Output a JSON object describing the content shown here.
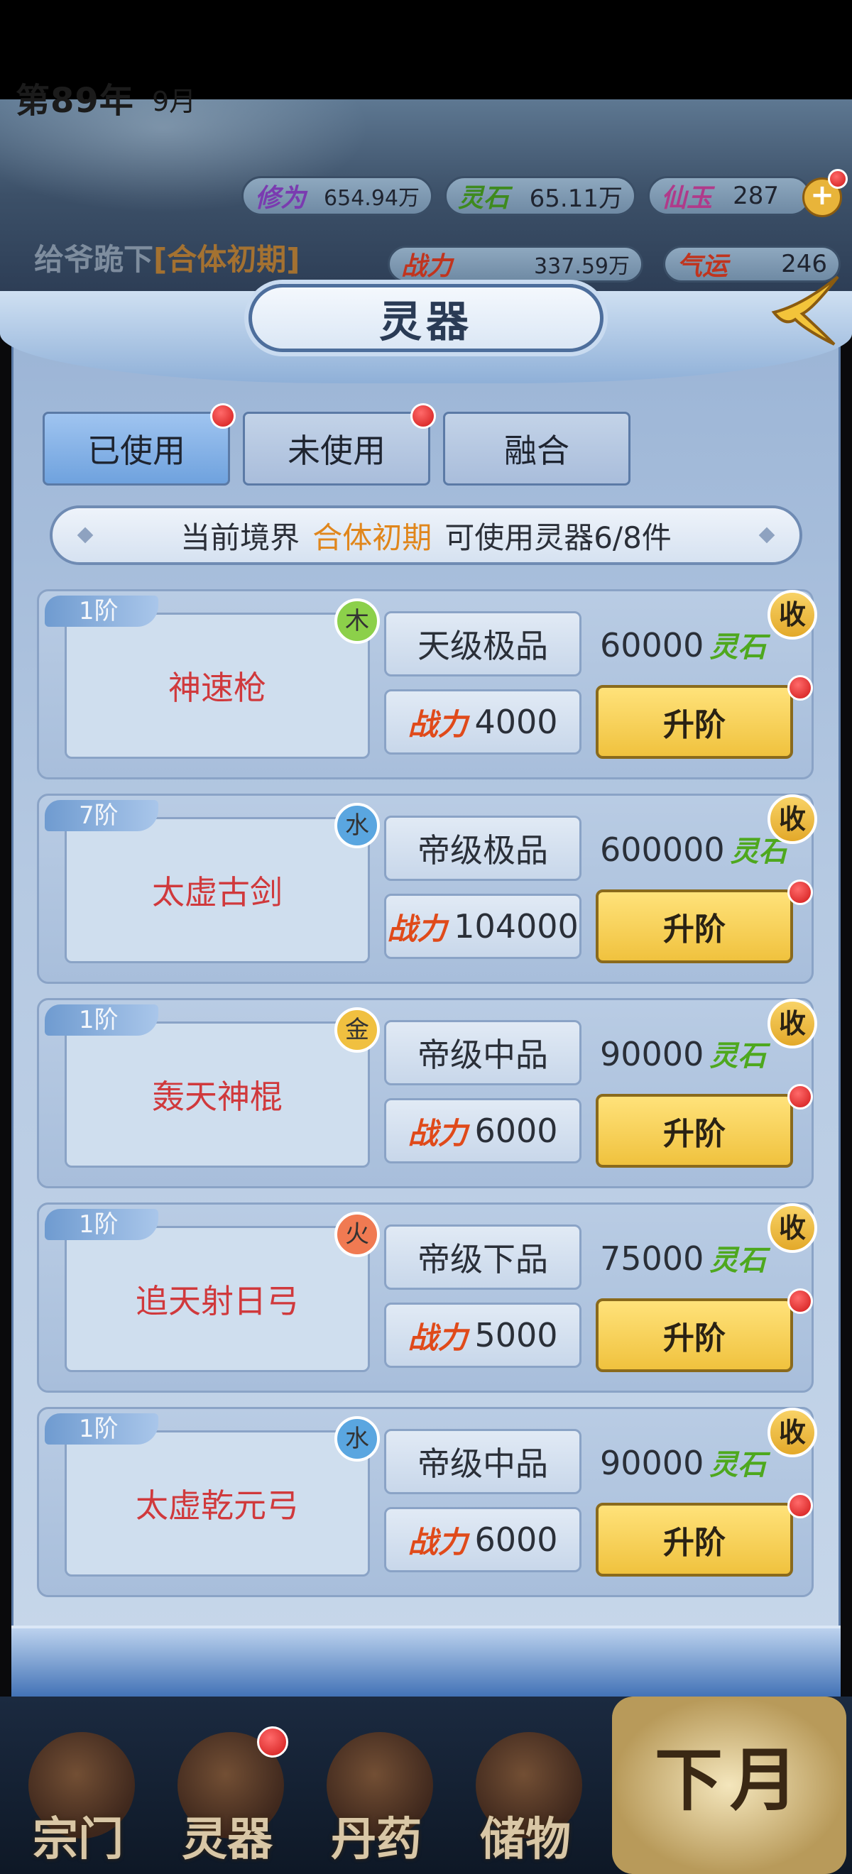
{
  "hud": {
    "year": "第89年",
    "month": "9月",
    "xiuwei_label": "修为",
    "xiuwei_value": "654.94万",
    "lingshi_label": "灵石",
    "lingshi_value": "65.11万",
    "xianyu_label": "仙玉",
    "xianyu_value": "287",
    "plus": "+",
    "player_name": "给爷跪下",
    "player_realm": "[合体初期]",
    "zhanli_label": "战力",
    "zhanli_value": "337.59万",
    "qiyun_label": "气运",
    "qiyun_value": "246"
  },
  "dialog": {
    "title": "灵器",
    "tabs": [
      "已使用",
      "未使用",
      "融合"
    ],
    "realm_prefix": "当前境界",
    "realm_value": "合体初期",
    "realm_suffix": "可使用灵器6/8件"
  },
  "items": [
    {
      "tier": "1阶",
      "element": "木",
      "name": "神速枪",
      "grade": "天级极品",
      "power_label": "战力",
      "power": "4000",
      "cost": "60000",
      "cost_label": "灵石",
      "upgrade": "升阶",
      "collect": "收"
    },
    {
      "tier": "7阶",
      "element": "水",
      "name": "太虚古剑",
      "grade": "帝级极品",
      "power_label": "战力",
      "power": "104000",
      "cost": "600000",
      "cost_label": "灵石",
      "upgrade": "升阶",
      "collect": "收"
    },
    {
      "tier": "1阶",
      "element": "金",
      "name": "轰天神棍",
      "grade": "帝级中品",
      "power_label": "战力",
      "power": "6000",
      "cost": "90000",
      "cost_label": "灵石",
      "upgrade": "升阶",
      "collect": "收"
    },
    {
      "tier": "1阶",
      "element": "火",
      "name": "追天射日弓",
      "grade": "帝级下品",
      "power_label": "战力",
      "power": "5000",
      "cost": "75000",
      "cost_label": "灵石",
      "upgrade": "升阶",
      "collect": "收"
    },
    {
      "tier": "1阶",
      "element": "水",
      "name": "太虚乾元弓",
      "grade": "帝级中品",
      "power_label": "战力",
      "power": "6000",
      "cost": "90000",
      "cost_label": "灵石",
      "upgrade": "升阶",
      "collect": "收"
    }
  ],
  "element_colors": {
    "木": "#8cd04a",
    "水": "#5aa6e0",
    "金": "#f0c040",
    "火": "#f07a52"
  },
  "nav": {
    "items": [
      "宗门",
      "灵器",
      "丹药",
      "储物"
    ],
    "next_month": "下月"
  }
}
